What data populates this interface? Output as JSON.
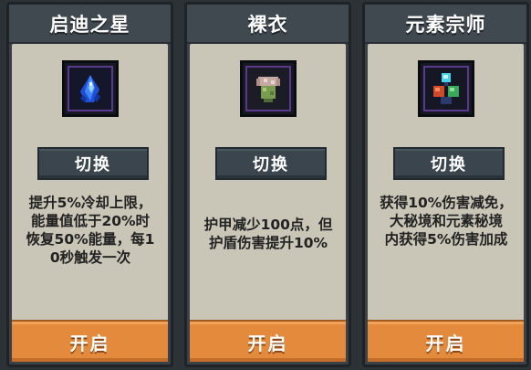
{
  "skills": [
    {
      "title": "启迪之星",
      "icon": "blue-crystal-icon",
      "switch_label": "切换",
      "description": "提升5%冷却上限，\n能量值低于20%时\n恢复50%能量，每1\n0秒触发一次",
      "open_label": "开启"
    },
    {
      "title": "裸衣",
      "icon": "bare-armor-icon",
      "switch_label": "切换",
      "description": "护甲减少100点，但\n护盾伤害提升10%",
      "open_label": "开启"
    },
    {
      "title": "元素宗师",
      "icon": "element-cube-icon",
      "switch_label": "切换",
      "description": "获得10%伤害减免，\n大秘境和元素秘境\n内获得5%伤害加成",
      "open_label": "开启"
    }
  ]
}
